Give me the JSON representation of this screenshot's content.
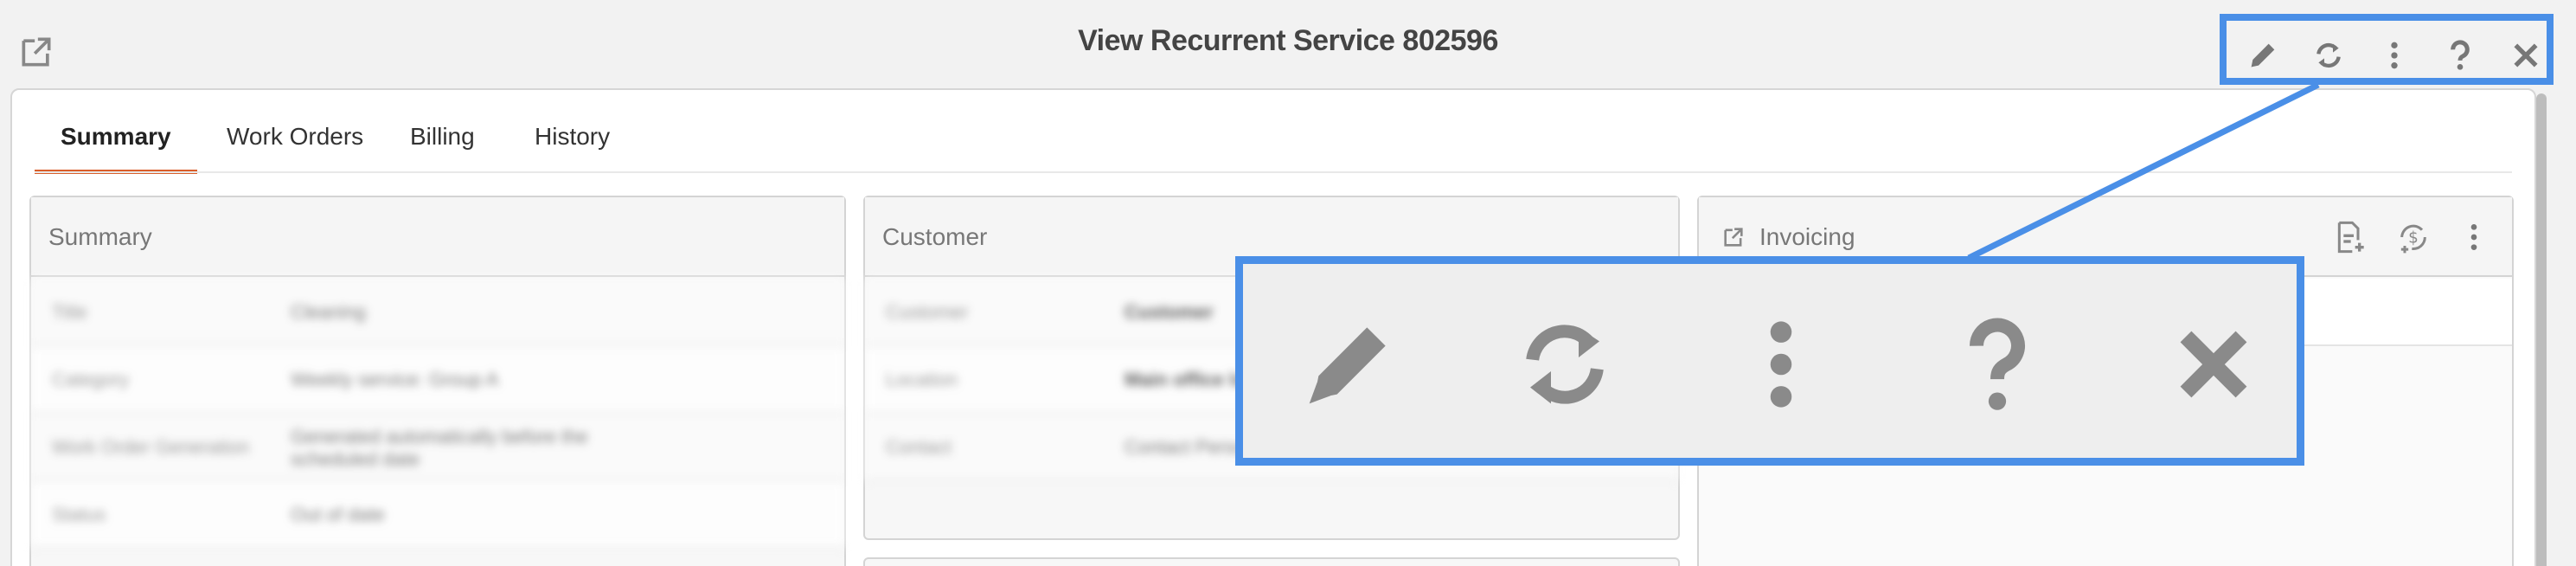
{
  "header": {
    "title": "View Recurrent Service 802596",
    "toolbar": [
      "pencil-icon",
      "refresh-icon",
      "more-vertical-icon",
      "help-icon",
      "close-icon"
    ]
  },
  "tabs": [
    {
      "label": "Summary",
      "active": true
    },
    {
      "label": "Work Orders",
      "active": false
    },
    {
      "label": "Billing",
      "active": false
    },
    {
      "label": "History",
      "active": false
    }
  ],
  "cards": {
    "summary": {
      "title": "Summary",
      "rows": [
        {
          "key": "Title",
          "value": "Cleaning"
        },
        {
          "key": "Category",
          "value": "Weekly service: Group A"
        },
        {
          "key": "Work Order Generation",
          "value": "Generated automatically before the scheduled date"
        },
        {
          "key": "Status",
          "value": "Out of date"
        }
      ]
    },
    "customer": {
      "title": "Customer",
      "rows": [
        {
          "key": "Customer",
          "value": "Customer"
        },
        {
          "key": "Location",
          "value": "Main office location"
        },
        {
          "key": "Contact",
          "value": "Contact Person"
        }
      ]
    },
    "invoicing": {
      "title": "Invoicing"
    }
  },
  "colors": {
    "accent_tab": "#d95f2b",
    "highlight": "#4a8fe7",
    "icon_gray": "#777777"
  }
}
